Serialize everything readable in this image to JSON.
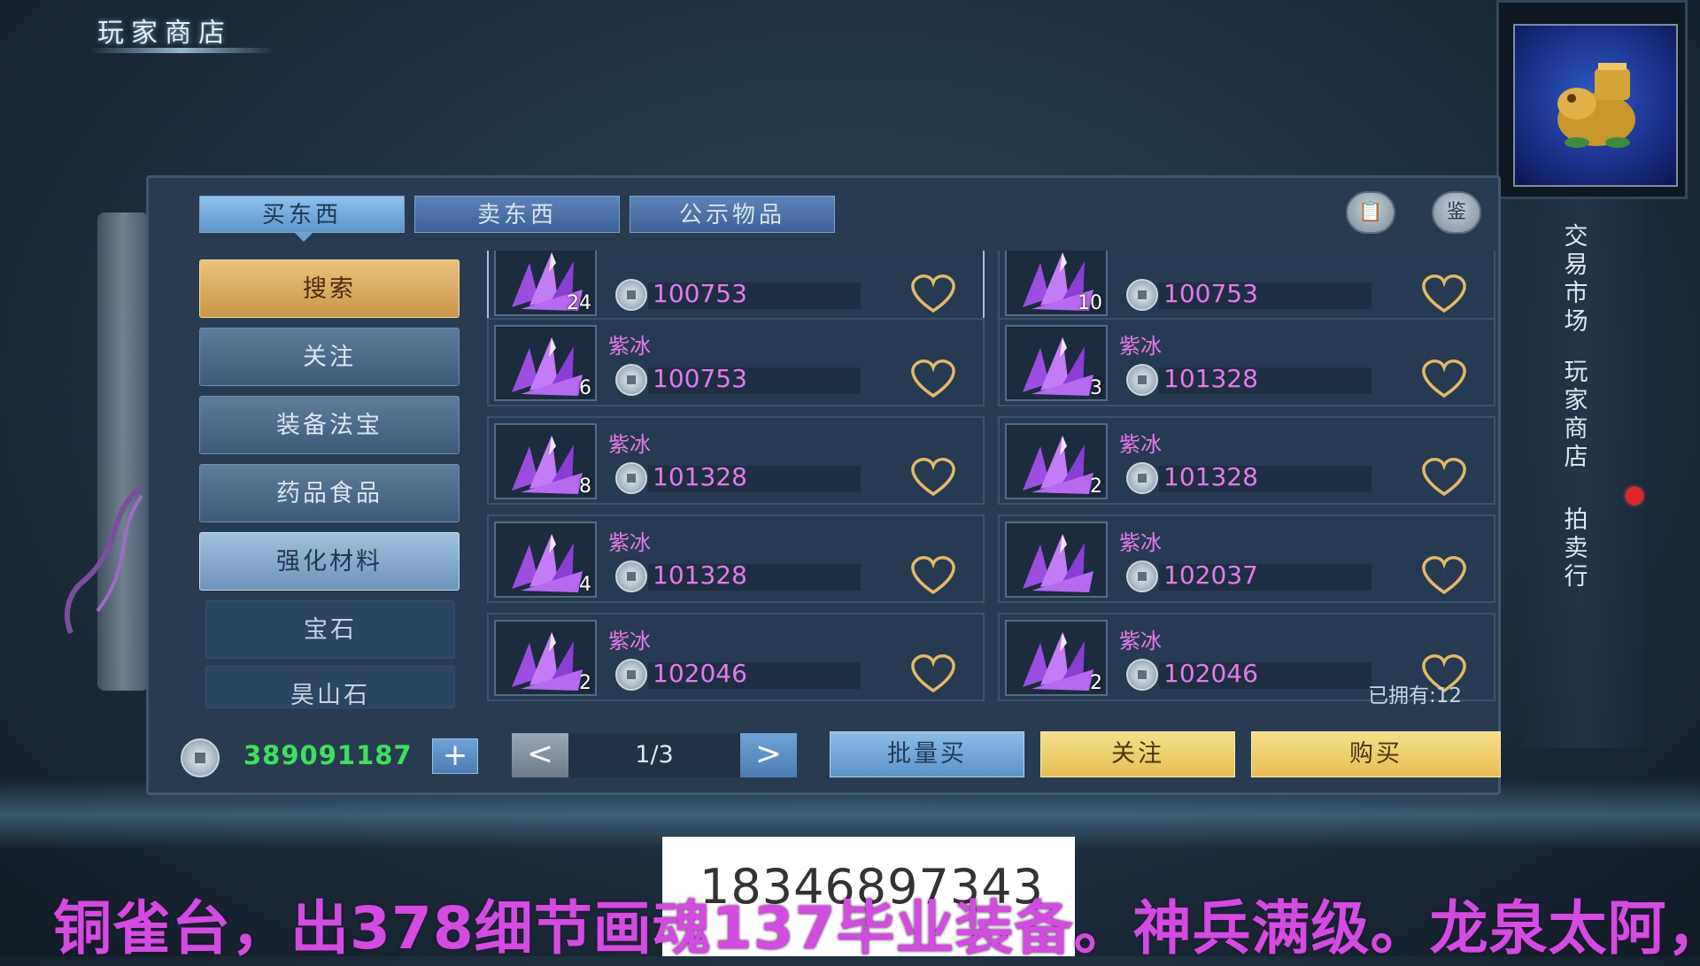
{
  "shop_title": "玩家商店",
  "tabs": [
    "买东西",
    "卖东西",
    "公示物品"
  ],
  "icon_buttons": {
    "list_icon": "📋",
    "appraise_label": "鉴"
  },
  "categories": [
    "搜索",
    "关注",
    "装备法宝",
    "药品食品",
    "强化材料",
    "宝石",
    "昊山石"
  ],
  "items": [
    {
      "name": "",
      "qty": "24",
      "price": "100753"
    },
    {
      "name": "",
      "qty": "10",
      "price": "100753"
    },
    {
      "name": "紫冰",
      "qty": "6",
      "price": "100753"
    },
    {
      "name": "紫冰",
      "qty": "3",
      "price": "101328"
    },
    {
      "name": "紫冰",
      "qty": "8",
      "price": "101328"
    },
    {
      "name": "紫冰",
      "qty": "2",
      "price": "101328"
    },
    {
      "name": "紫冰",
      "qty": "4",
      "price": "101328"
    },
    {
      "name": "紫冰",
      "qty": "",
      "price": "102037"
    },
    {
      "name": "紫冰",
      "qty": "2",
      "price": "102046"
    },
    {
      "name": "紫冰",
      "qty": "2",
      "price": "102046"
    }
  ],
  "owned_text": "已拥有:12",
  "money": "389091187",
  "plus_label": "+",
  "pager": {
    "prev": "<",
    "text": "1/3",
    "next": ">"
  },
  "actions": {
    "bulk_buy": "批量买",
    "follow": "关注",
    "buy": "购买"
  },
  "side_nav": [
    "交易市场",
    "玩家商店",
    "拍卖行"
  ],
  "overlay": {
    "phone": "18346897343",
    "subtitle": "铜雀台，出378细节画魂137毕业装备。神兵满级。龙泉太阿，"
  },
  "colors": {
    "item_name": "#e67ae8",
    "money": "#3ee05c",
    "subtitle": "#d34be0"
  }
}
